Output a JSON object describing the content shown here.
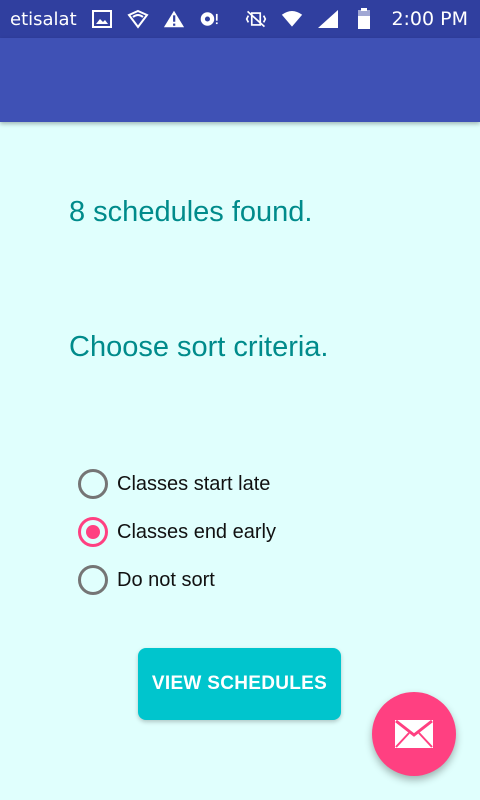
{
  "status_bar": {
    "carrier": "etisalat",
    "time": "2:00 PM",
    "left_icons": [
      "image-icon",
      "wifi-shield-icon",
      "warning-icon",
      "record-icon"
    ],
    "right_icons": [
      "vibrate-icon",
      "wifi-signal-icon",
      "cell-signal-icon",
      "battery-icon"
    ]
  },
  "main": {
    "result_text": "8 schedules found.",
    "prompt_text": "Choose sort criteria.",
    "sort_options": [
      {
        "label": "Classes start late",
        "checked": false
      },
      {
        "label": "Classes end early",
        "checked": true
      },
      {
        "label": "Do not sort",
        "checked": false
      }
    ],
    "view_button_label": "VIEW SCHEDULES"
  },
  "fab": {
    "icon": "mail-icon"
  },
  "colors": {
    "status_bar": "#303F9F",
    "app_bar": "#3F51B5",
    "background": "#E0FFFD",
    "headline": "#008B8B",
    "accent": "#FF4081",
    "button": "#00C5CD"
  }
}
